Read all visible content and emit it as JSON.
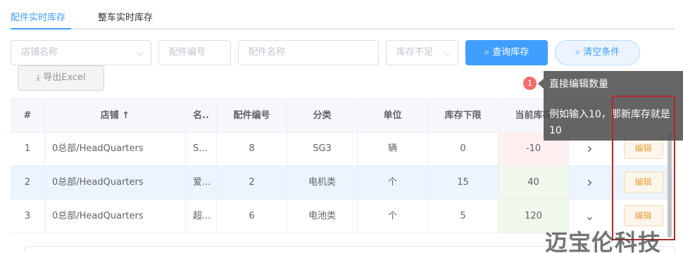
{
  "tabs": [
    {
      "label": "配件实时库存",
      "active": true
    },
    {
      "label": "整车实时库存",
      "active": false
    }
  ],
  "filters": {
    "shop_placeholder": "店铺名称",
    "part_no_placeholder": "配件编号",
    "part_name_placeholder": "配件名称",
    "stock_low_placeholder": "库存不足",
    "query_label": "查询库存",
    "clear_label": "清空条件",
    "export_label": "导出Excel"
  },
  "table": {
    "headers": {
      "index": "#",
      "shop": "店铺 ↑",
      "name": "名..",
      "part_no": "配件编号",
      "category": "分类",
      "unit": "单位",
      "min_stock": "库存下限",
      "current_stock": "当前库存"
    },
    "rows": [
      {
        "index": "1",
        "shop": "0总部/HeadQuarters",
        "name": "S...",
        "part_no": "8",
        "category": "SG3",
        "unit": "辆",
        "min_stock": "0",
        "current_stock": "-10",
        "stock_status": "low",
        "expand": "›",
        "action": "编辑"
      },
      {
        "index": "2",
        "shop": "0总部/HeadQuarters",
        "name": "爱...",
        "part_no": "2",
        "category": "电机类",
        "unit": "个",
        "min_stock": "15",
        "current_stock": "40",
        "stock_status": "ok",
        "expand": "›",
        "action": "编辑"
      },
      {
        "index": "3",
        "shop": "0总部/HeadQuarters",
        "name": "超...",
        "part_no": "6",
        "category": "电池类",
        "unit": "个",
        "min_stock": "5",
        "current_stock": "120",
        "stock_status": "ok",
        "expand": "⌄",
        "action": "编辑"
      }
    ]
  },
  "tooltip": {
    "badge": "1",
    "title": "直接编辑数量",
    "body": "例如输入10，那新库存就是10"
  },
  "watermark": "迈宝伦科技",
  "colors": {
    "primary": "#409eff",
    "warning": "#e6a23c",
    "danger": "#f56c6c",
    "highlight_border": "#b02a2a"
  }
}
